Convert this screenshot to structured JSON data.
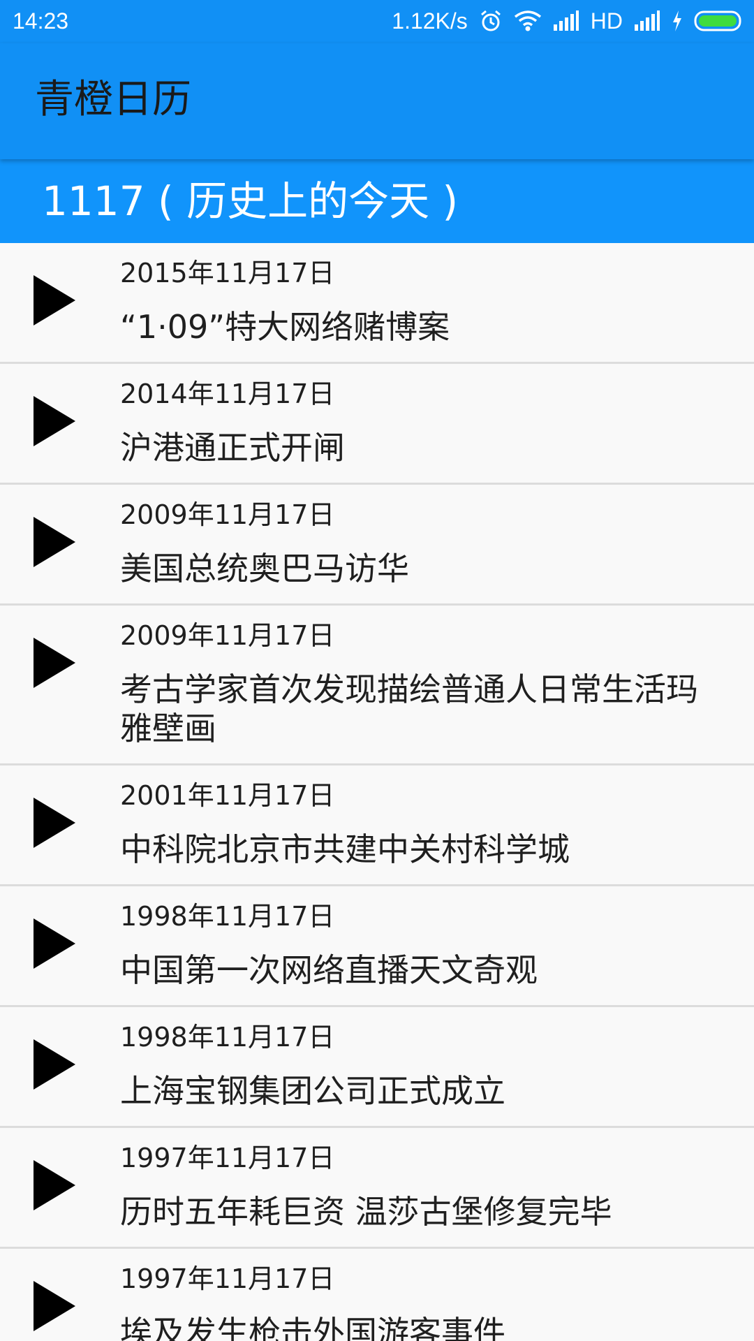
{
  "status_bar": {
    "time": "14:23",
    "network_speed": "1.12K/s",
    "hd_label": "HD",
    "icons": [
      "alarm-icon",
      "wifi-icon",
      "signal-icon",
      "signal-icon",
      "charging-icon",
      "battery-icon"
    ]
  },
  "app_bar": {
    "title": "青橙日历",
    "background": "#1190f5"
  },
  "section": {
    "title": "1117 ( 历史上的今天 )",
    "background": "#1194fb"
  },
  "events": [
    {
      "date": "2015年11月17日",
      "title": "“1·09”特大网络赌博案"
    },
    {
      "date": "2014年11月17日",
      "title": "沪港通正式开闸"
    },
    {
      "date": "2009年11月17日",
      "title": "美国总统奥巴马访华"
    },
    {
      "date": "2009年11月17日",
      "title": "考古学家首次发现描绘普通人日常生活玛雅壁画"
    },
    {
      "date": "2001年11月17日",
      "title": "中科院北京市共建中关村科学城"
    },
    {
      "date": "1998年11月17日",
      "title": "中国第一次网络直播天文奇观"
    },
    {
      "date": "1998年11月17日",
      "title": "上海宝钢集团公司正式成立"
    },
    {
      "date": "1997年11月17日",
      "title": "历时五年耗巨资 温莎古堡修复完毕"
    },
    {
      "date": "1997年11月17日",
      "title": "埃及发生枪击外国游客事件"
    }
  ]
}
